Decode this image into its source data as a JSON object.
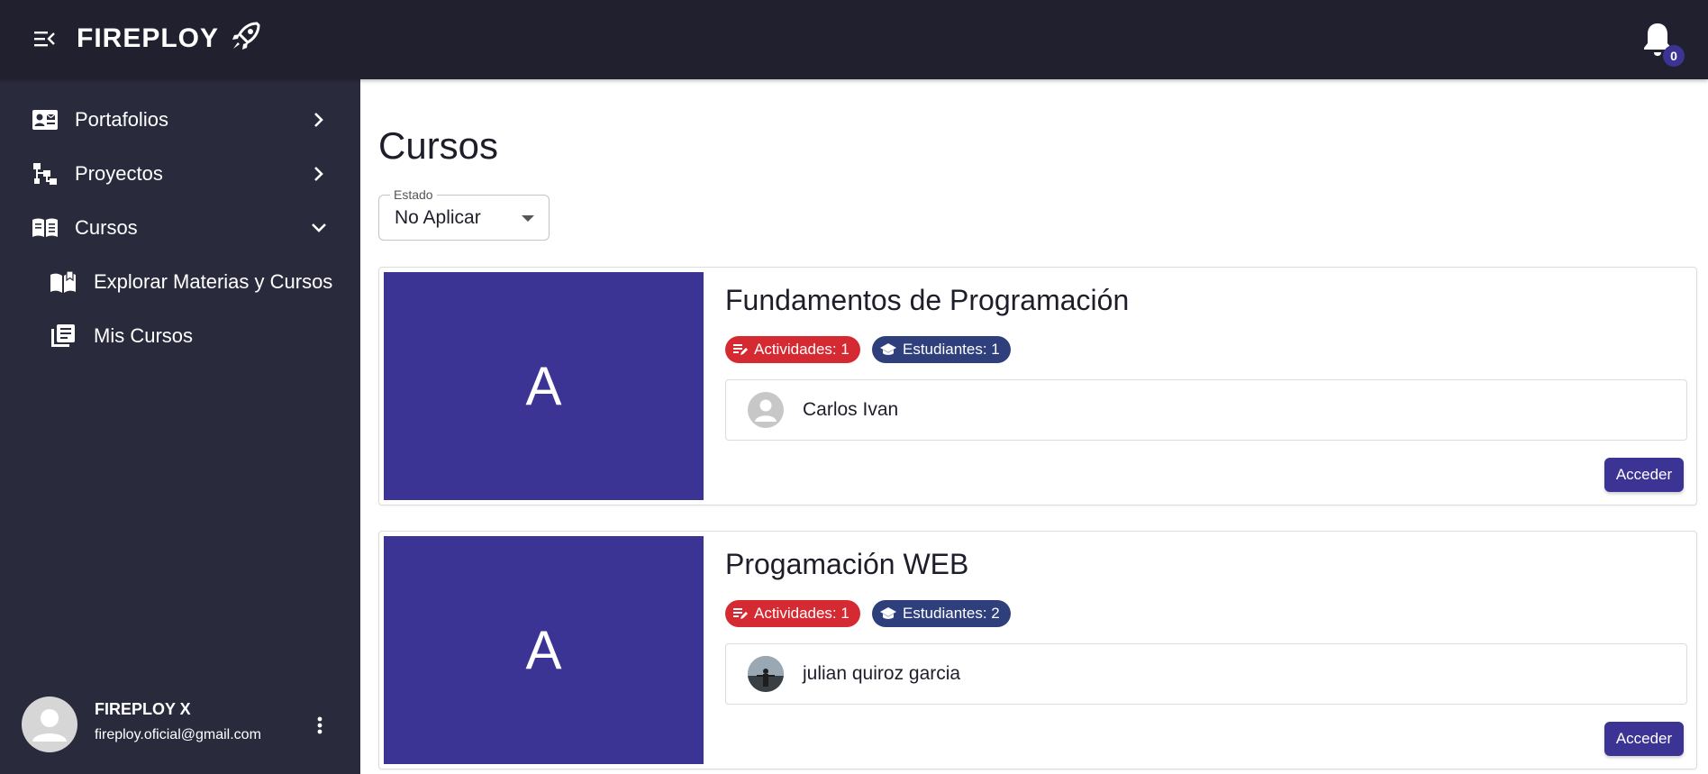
{
  "app": {
    "brand": "FIREPLOY",
    "notifications_count": "0"
  },
  "sidebar": {
    "items": [
      {
        "label": "Portafolios",
        "icon": "portfolio-card-icon"
      },
      {
        "label": "Proyectos",
        "icon": "project-tree-icon"
      },
      {
        "label": "Cursos",
        "icon": "open-book-icon",
        "expanded": true
      }
    ],
    "sub_items": [
      {
        "label": "Explorar Materias y Cursos",
        "icon": "book-explore-icon"
      },
      {
        "label": "Mis Cursos",
        "icon": "library-books-icon"
      }
    ],
    "user": {
      "name": "FIREPLOY X",
      "email": "fireploy.oficial@gmail.com"
    }
  },
  "main": {
    "title": "Cursos",
    "filter": {
      "legend": "Estado",
      "value": "No Aplicar"
    },
    "courses": [
      {
        "thumb_letter": "A",
        "title": "Fundamentos de Programación",
        "activities": "Actividades: 1",
        "students": "Estudiantes: 1",
        "teacher": "Carlos Ivan",
        "button": "Acceder"
      },
      {
        "thumb_letter": "A",
        "title": "Progamación WEB",
        "activities": "Actividades: 1",
        "students": "Estudiantes: 2",
        "teacher": "julian quiroz garcia",
        "button": "Acceder"
      }
    ]
  },
  "colors": {
    "topbar": "#20202f",
    "sidebar": "#2a2a3d",
    "primary": "#3b3494",
    "chip_red": "#d62a33",
    "chip_blue": "#2e3f7c"
  }
}
